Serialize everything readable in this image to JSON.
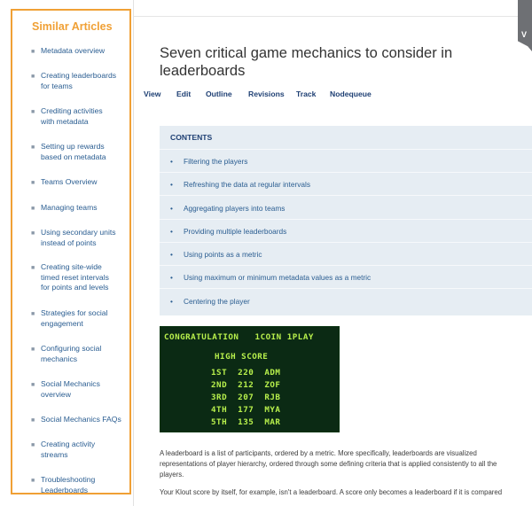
{
  "sidebar": {
    "title": "Similar Articles",
    "items": [
      {
        "lines": [
          "Metadata overview"
        ]
      },
      {
        "lines": [
          "Creating leaderboards",
          "for teams"
        ]
      },
      {
        "lines": [
          "Crediting activities",
          "with metadata"
        ]
      },
      {
        "lines": [
          "Setting up rewards",
          "based on metadata"
        ]
      },
      {
        "lines": [
          "Teams Overview"
        ]
      },
      {
        "lines": [
          "Managing teams"
        ]
      },
      {
        "lines": [
          "Using secondary units",
          "instead of points"
        ]
      },
      {
        "lines": [
          "Creating site-wide",
          "timed reset intervals",
          "for points and levels"
        ]
      },
      {
        "lines": [
          "Strategies for social",
          "engagement"
        ]
      },
      {
        "lines": [
          "Configuring social",
          "mechanics"
        ]
      },
      {
        "lines": [
          "Social Mechanics",
          "overview"
        ]
      },
      {
        "lines": [
          "Social Mechanics FAQs"
        ]
      },
      {
        "lines": [
          "Creating activity",
          "streams"
        ]
      },
      {
        "lines": [
          "Troubleshooting",
          "Leaderboards"
        ]
      }
    ]
  },
  "corner_badge": "V",
  "article": {
    "title_line1": "Seven critical game mechanics to consider in",
    "title_line2": "leaderboards",
    "tabs": [
      "View",
      "Edit",
      "Outline",
      "Revisions",
      "Track",
      "Nodequeue"
    ]
  },
  "contents": {
    "heading": "CONTENTS",
    "bullet": "•",
    "items": [
      "Filtering the players",
      "Refreshing the data at regular intervals",
      "Aggregating players into teams",
      "Providing multiple leaderboards",
      "Using points as a metric",
      "Using maximum or minimum metadata values as a metric",
      "Centering the player"
    ]
  },
  "arcade": {
    "header": "CONGRATULATION   1COIN 1PLAY",
    "subheader": "HIGH SCORE",
    "rows": [
      "1ST  220  ADM",
      "2ND  212  ZOF",
      "3RD  207  RJB",
      "4TH  177  MYA",
      "5TH  135  MAR"
    ]
  },
  "paragraphs": [
    "A leaderboard is a list of participants, ordered by a metric. More specifically, leaderboards are visualized",
    "representations of player hierarchy, ordered through some defining criteria that is applied consistently to all the",
    "players.",
    "Your Klout score by itself, for example, isn't a leaderboard. A score only becomes a leaderboard if it is compared"
  ],
  "colors": {
    "sidebar_border": "#f0a035",
    "link": "#2a5d91",
    "tab": "#1e3f73",
    "contents_bg": "#e6edf3",
    "arcade_bg": "#0b2a14",
    "arcade_text": "#b8f04c"
  }
}
